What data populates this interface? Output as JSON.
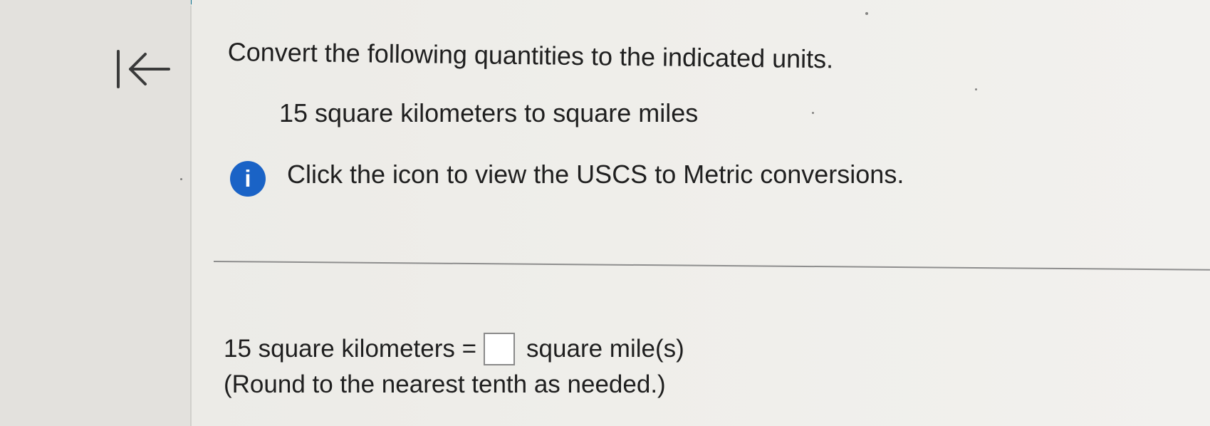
{
  "colors": {
    "top_bar": "#0b6f8f",
    "info_icon": "#1a63c6",
    "text": "#1f1f1f",
    "background": "#efeeea"
  },
  "navigation": {
    "first_page_icon": "arrow-left-to-bar-icon"
  },
  "question": {
    "title": "Convert the following quantities to the indicated units.",
    "problem": "15 square kilometers to square miles",
    "info_icon": "info-icon",
    "info_icon_glyph": "i",
    "info_text": "Click the icon to view the USCS to Metric conversions."
  },
  "answer": {
    "label": "15 square kilometers =",
    "input_value": "",
    "unit": "square mile(s)",
    "note": "(Round to the nearest tenth as needed.)"
  }
}
